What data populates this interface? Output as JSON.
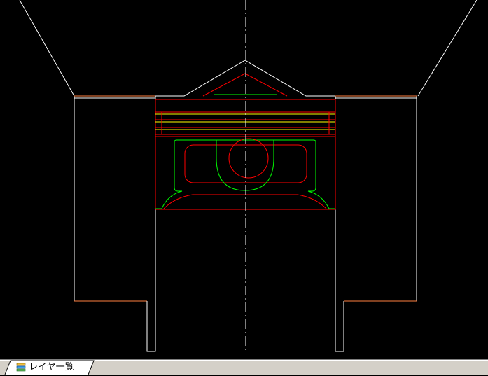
{
  "layer_tabs": {
    "items": [
      {
        "label": "レイヤ一覧",
        "icon": "layer-stack-icon",
        "active": true
      }
    ]
  },
  "colors": {
    "background": "#000000",
    "white": "#ffffff",
    "red": "#ff0000",
    "green": "#00ff00",
    "yellow": "#ffff00",
    "orange": "#ff8040",
    "tabbar": "#d4d0c8"
  }
}
